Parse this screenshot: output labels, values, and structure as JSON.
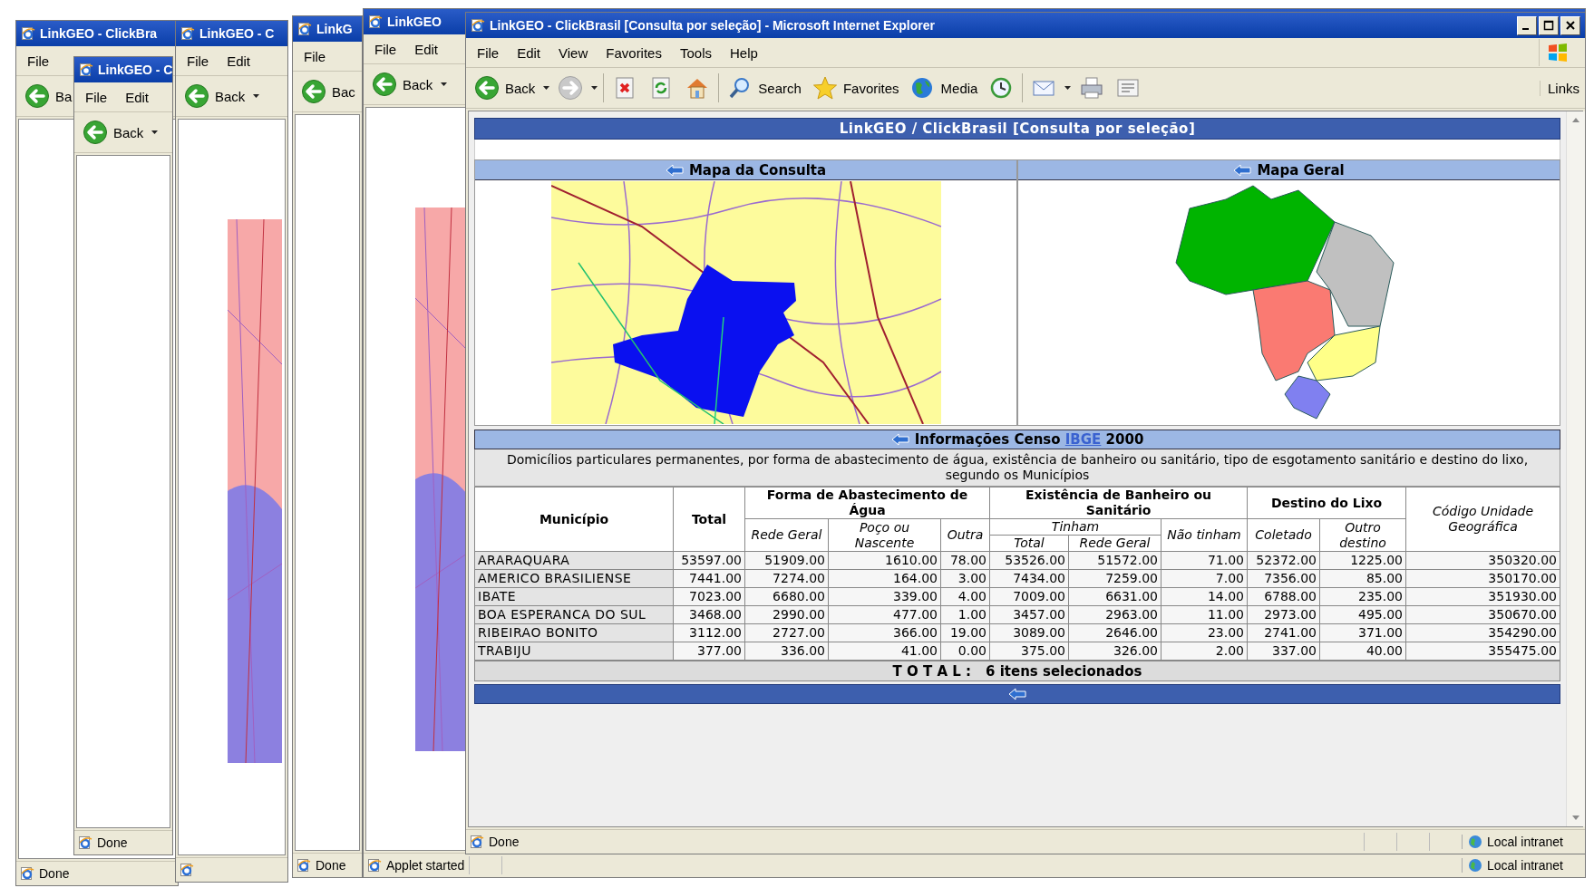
{
  "background_windows": [
    {
      "title": "LinkGEO - ClickBra",
      "menu": [
        "File"
      ],
      "back": "Ba",
      "status": "Done",
      "shows_map": false
    },
    {
      "title": "LinkGEO - C",
      "menu": [
        "File",
        "Edit"
      ],
      "back": "Back",
      "status": "Done",
      "shows_map": false
    },
    {
      "title": "LinkGEO - C",
      "menu": [
        "File",
        "Edit"
      ],
      "back": "Back",
      "shows_map": true
    },
    {
      "title": "LinkG",
      "menu": [
        "File"
      ],
      "back": "Bac",
      "status": "Done",
      "shows_map": false
    },
    {
      "title": "LinkGEO",
      "menu": [
        "File",
        "Edit"
      ],
      "back": "Back",
      "status": "Applet started",
      "zone": "Local intranet",
      "shows_map": true
    }
  ],
  "main_window": {
    "title": "LinkGEO - ClickBrasil [Consulta por seleção] - Microsoft Internet Explorer",
    "menu": [
      "File",
      "Edit",
      "View",
      "Favorites",
      "Tools",
      "Help"
    ],
    "toolbar": [
      {
        "kind": "back",
        "label": "Back"
      },
      {
        "kind": "forward"
      },
      {
        "kind": "stop"
      },
      {
        "kind": "refresh"
      },
      {
        "kind": "home"
      },
      {
        "kind": "search",
        "label": "Search"
      },
      {
        "kind": "favorites",
        "label": "Favorites"
      },
      {
        "kind": "media",
        "label": "Media"
      },
      {
        "kind": "history"
      },
      {
        "kind": "mail"
      },
      {
        "kind": "print"
      },
      {
        "kind": "edit"
      }
    ],
    "links": "Links",
    "status": "Done",
    "zone": "Local intranet"
  },
  "page": {
    "header": "LinkGEO / ClickBrasil [Consulta por seleção]",
    "map_panels": [
      {
        "title": "Mapa da Consulta",
        "kind": "region"
      },
      {
        "title": "Mapa Geral",
        "kind": "country"
      }
    ],
    "census": {
      "title_before": "Informações Censo",
      "link": "IBGE",
      "title_after": "2000",
      "description": "Domicílios particulares permanentes, por forma de abastecimento de água, existência de banheiro ou sanitário, tipo de esgotamento sanitário e destino do lixo, segundo os Municípios",
      "header": {
        "municipio": "Município",
        "total": "Total",
        "water": {
          "title": "Forma de Abastecimento de Água",
          "columns": [
            "Rede Geral",
            "Poço ou Nascente",
            "Outra"
          ]
        },
        "bathroom": {
          "title": "Existência de Banheiro ou Sanitário",
          "had": "Tinham",
          "had_columns": [
            "Total",
            "Rede Geral"
          ],
          "had_not": "Não tinham"
        },
        "waste": {
          "title": "Destino do Lixo",
          "columns": [
            "Coletado",
            "Outro destino"
          ]
        },
        "code": "Código Unidade Geográfica"
      },
      "rows": [
        [
          "ARARAQUARA",
          "53597.00",
          "51909.00",
          "1610.00",
          "78.00",
          "53526.00",
          "51572.00",
          "71.00",
          "52372.00",
          "1225.00",
          "350320.00"
        ],
        [
          "AMERICO BRASILIENSE",
          "7441.00",
          "7274.00",
          "164.00",
          "3.00",
          "7434.00",
          "7259.00",
          "7.00",
          "7356.00",
          "85.00",
          "350170.00"
        ],
        [
          "IBATE",
          "7023.00",
          "6680.00",
          "339.00",
          "4.00",
          "7009.00",
          "6631.00",
          "14.00",
          "6788.00",
          "235.00",
          "351930.00"
        ],
        [
          "BOA ESPERANCA DO SUL",
          "3468.00",
          "2990.00",
          "477.00",
          "1.00",
          "3457.00",
          "2963.00",
          "11.00",
          "2973.00",
          "495.00",
          "350670.00"
        ],
        [
          "RIBEIRAO BONITO",
          "3112.00",
          "2727.00",
          "366.00",
          "19.00",
          "3089.00",
          "2646.00",
          "23.00",
          "2741.00",
          "371.00",
          "354290.00"
        ],
        [
          "TRABIJU",
          "377.00",
          "336.00",
          "41.00",
          "0.00",
          "375.00",
          "326.00",
          "2.00",
          "337.00",
          "40.00",
          "355475.00"
        ]
      ],
      "total_label": "T O T A L :",
      "total_count": "6 itens selecionados"
    }
  }
}
